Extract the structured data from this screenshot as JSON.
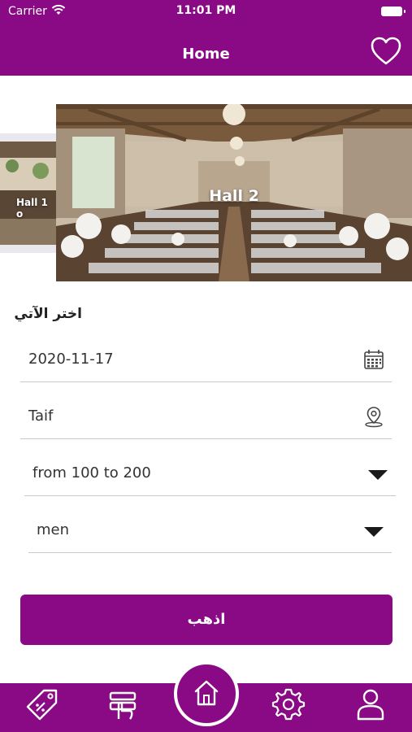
{
  "status_bar": {
    "carrier": "Carrier",
    "time": "11:01 PM"
  },
  "header": {
    "title": "Home"
  },
  "carousel": {
    "slides": [
      {
        "label": "Hall 1 o"
      },
      {
        "label": "Hall 2"
      }
    ]
  },
  "form": {
    "section_title": "اختر الآتي",
    "date": {
      "value": "2020-11-17"
    },
    "city": {
      "value": "Taif"
    },
    "capacity": {
      "selected": "from 100 to 200"
    },
    "gender": {
      "selected": "men"
    },
    "submit_label": "اذهب"
  },
  "tab_bar": {
    "items": [
      "offers",
      "bookings",
      "home",
      "settings",
      "profile"
    ]
  },
  "colors": {
    "primary": "#8a0a85",
    "background": "#ffffff"
  }
}
